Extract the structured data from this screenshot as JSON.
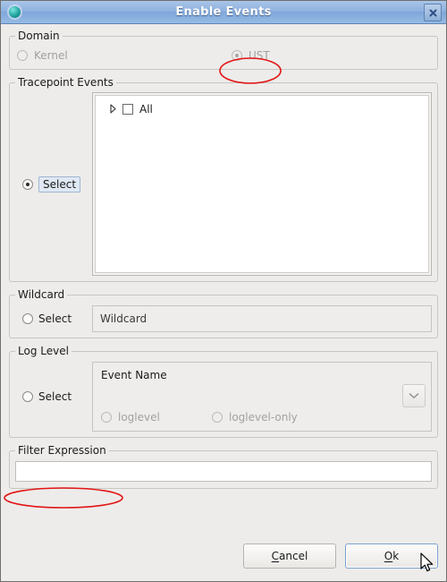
{
  "window": {
    "title": "Enable Events",
    "icon": "app-globe-icon",
    "close_label": "close-icon"
  },
  "domain": {
    "legend": "Domain",
    "options": [
      {
        "label": "Kernel",
        "selected": false,
        "disabled": true
      },
      {
        "label": "UST",
        "selected": true,
        "disabled": true
      }
    ]
  },
  "tracepoint": {
    "legend": "Tracepoint Events",
    "select_label": "Select",
    "select_checked": true,
    "tree": [
      {
        "label": "All",
        "checked": false,
        "expandable": true
      }
    ]
  },
  "wildcard": {
    "legend": "Wildcard",
    "select_label": "Select",
    "select_checked": false,
    "field_value": "Wildcard"
  },
  "loglevel": {
    "legend": "Log Level",
    "select_label": "Select",
    "select_checked": false,
    "event_name_value": "Event Name",
    "dropdown_icon": "chevron-down-icon",
    "options": [
      {
        "label": "loglevel",
        "selected": false,
        "disabled": true
      },
      {
        "label": "loglevel-only",
        "selected": false,
        "disabled": true
      }
    ]
  },
  "filter": {
    "legend": "Filter Expression",
    "value": "",
    "placeholder": ""
  },
  "buttons": {
    "cancel": {
      "mnemonic": "C",
      "rest": "ancel"
    },
    "ok": {
      "pre": "O",
      "mnemonic": "k",
      "rest": ""
    },
    "cancel_label": "Cancel",
    "ok_label": "Ok"
  },
  "annotations": {
    "colors": {
      "highlight": "#e21515"
    },
    "items": [
      {
        "target": "UST radio option"
      },
      {
        "target": "Filter Expression legend"
      }
    ]
  }
}
